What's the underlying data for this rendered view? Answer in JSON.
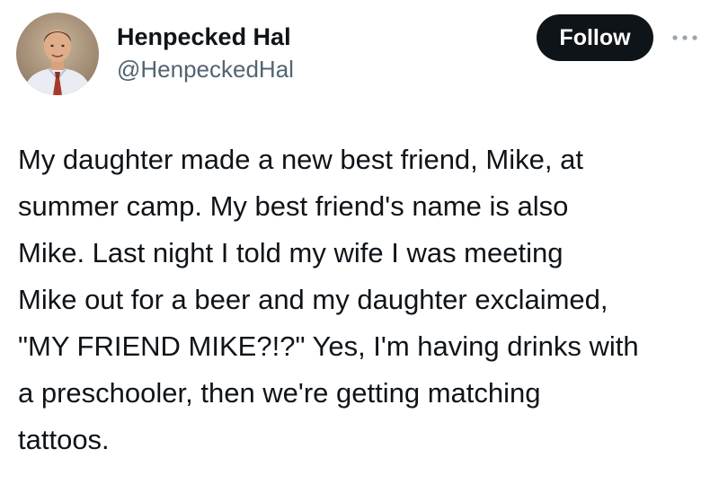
{
  "author": {
    "display_name": "Henpecked Hal",
    "handle": "@HenpeckedHal",
    "avatar_icon": "profile-photo-avatar"
  },
  "actions": {
    "follow_label": "Follow",
    "more_icon": "more-options-icon"
  },
  "tweet": {
    "lines": [
      "My daughter made a new best friend, Mike, at",
      "summer camp. My best friend's name is also",
      "Mike. Last night I told my wife I was meeting",
      "Mike out for a beer and my daughter exclaimed,",
      "\"MY FRIEND MIKE?!?\" Yes, I'm having drinks with",
      "a preschooler, then we're getting matching",
      "tattoos."
    ]
  },
  "colors": {
    "text_primary": "#0f1419",
    "text_secondary": "#536471",
    "follow_button_bg": "#0f1419",
    "follow_button_text": "#ffffff"
  }
}
